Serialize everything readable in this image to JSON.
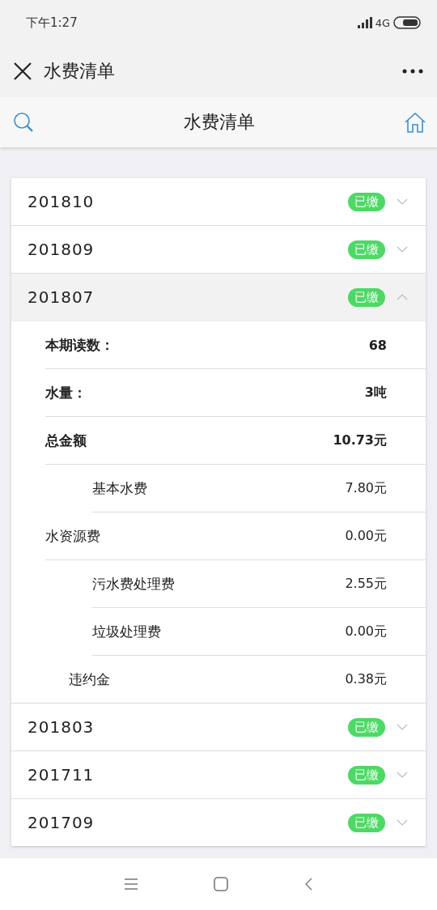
{
  "status_bar": {
    "time": "下午1:27",
    "network": "4G"
  },
  "nav": {
    "title": "水费清单"
  },
  "header": {
    "title": "水费清单"
  },
  "bills": [
    {
      "month": "201810",
      "badge": "已缴",
      "expanded": false
    },
    {
      "month": "201809",
      "badge": "已缴",
      "expanded": false
    },
    {
      "month": "201807",
      "badge": "已缴",
      "expanded": true,
      "details": [
        {
          "kind": "summary",
          "label": "本期读数：",
          "value": "68"
        },
        {
          "kind": "summary",
          "label": "水量：",
          "value": "3吨"
        },
        {
          "kind": "summary",
          "label": "总金额",
          "value": "10.73元"
        },
        {
          "kind": "sub",
          "label": "基本水费",
          "value": "7.80元"
        },
        {
          "kind": "main",
          "label": "水资源费",
          "value": "0.00元"
        },
        {
          "kind": "sub",
          "label": "污水费处理费",
          "value": "2.55元"
        },
        {
          "kind": "sub",
          "label": "垃圾处理费",
          "value": "0.00元"
        },
        {
          "kind": "extra",
          "label": "违约金",
          "value": "0.38元"
        }
      ]
    },
    {
      "month": "201803",
      "badge": "已缴",
      "expanded": false
    },
    {
      "month": "201711",
      "badge": "已缴",
      "expanded": false
    },
    {
      "month": "201709",
      "badge": "已缴",
      "expanded": false
    }
  ]
}
